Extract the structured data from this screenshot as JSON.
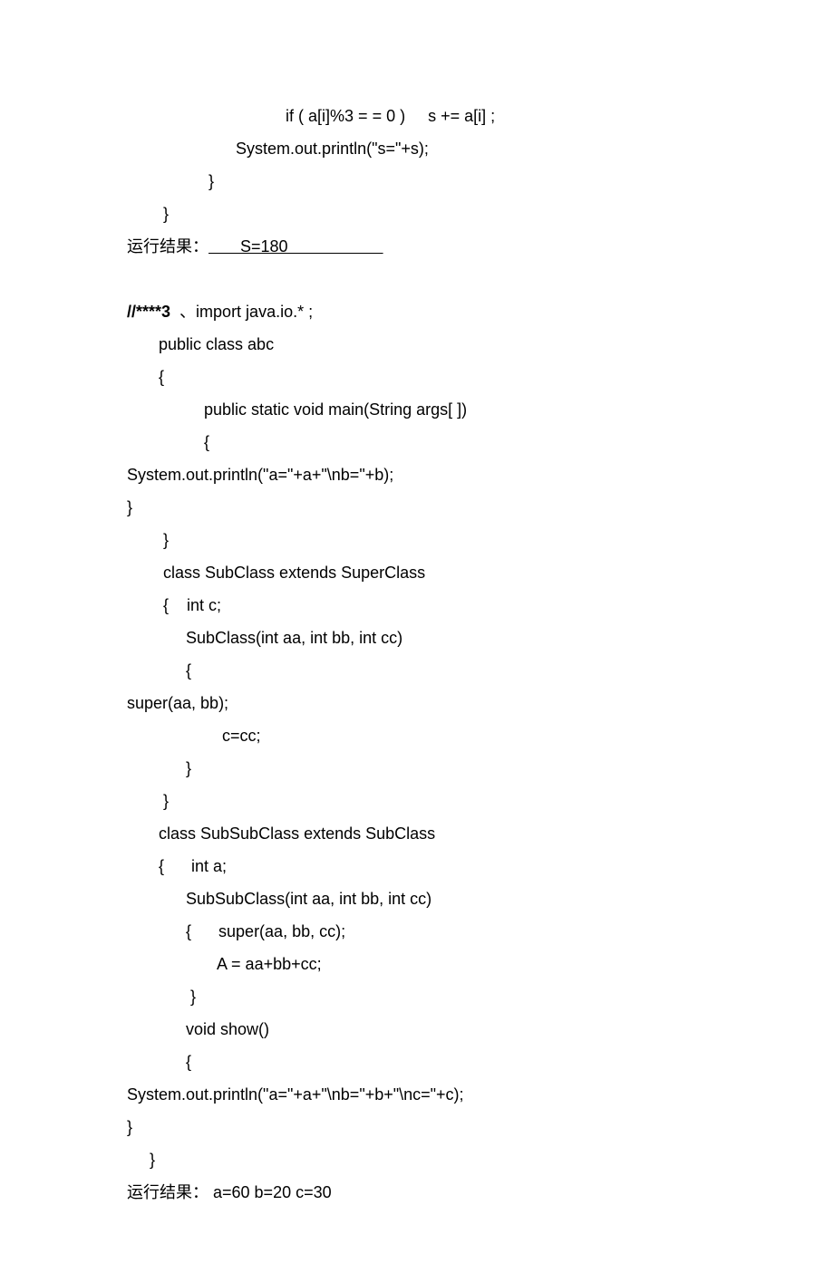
{
  "lines": {
    "l1": "                                   if ( a[i]%3 = = 0 )     s += a[i] ;",
    "l2": "                        System.out.println(\"s=\"+s);",
    "l3": "                  }",
    "l4": "        }",
    "l5a_cjk": "运行结果：",
    "l5b_under": "       S=180                     ",
    "l6_blank": " ",
    "l7a_bold": "//****3",
    "l7b": "  、import java.io.* ;",
    "l8": "       public class abc",
    "l9": "       {",
    "l10": "                 public static void main(String args[ ])",
    "l11": "                 {",
    "l12": "System.out.println(\"a=\"+a+\"\\nb=\"+b);",
    "l13": "}",
    "l14": "        }",
    "l15": "        class SubClass extends SuperClass",
    "l16": "        {    int c;",
    "l17": "             SubClass(int aa, int bb, int cc)",
    "l18": "             {",
    "l19": "super(aa, bb);",
    "l20": "                     c=cc;",
    "l21": "             }",
    "l22": "        }",
    "l23": "       class SubSubClass extends SubClass",
    "l24": "       {      int a;",
    "l25": "             SubSubClass(int aa, int bb, int cc)",
    "l26": "             {      super(aa, bb, cc);",
    "l27": "                    A = aa+bb+cc;",
    "l28": "              }",
    "l29": "             void show()",
    "l30": "             {",
    "l31": "System.out.println(\"a=\"+a+\"\\nb=\"+b+\"\\nc=\"+c);",
    "l32": "}",
    "l33": "     }",
    "l34a_cjk": "运行结果：",
    "l34b": " a=60 b=20 c=30"
  }
}
